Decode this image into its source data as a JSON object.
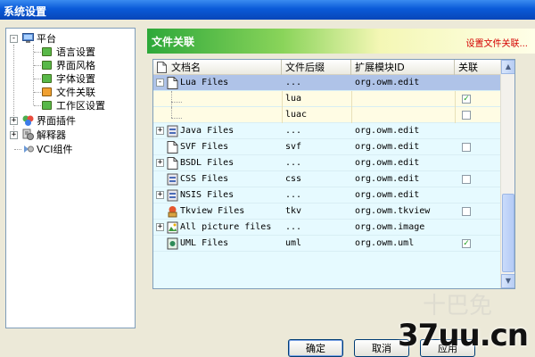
{
  "window": {
    "title": "系统设置"
  },
  "tree": {
    "nodes": [
      {
        "label": "平台",
        "icon": "monitor-icon",
        "expanded": true
      },
      {
        "label": "语言设置",
        "icon": "green-box-icon"
      },
      {
        "label": "界面风格",
        "icon": "green-box-icon"
      },
      {
        "label": "字体设置",
        "icon": "green-box-icon"
      },
      {
        "label": "文件关联",
        "icon": "orange-box-icon"
      },
      {
        "label": "工作区设置",
        "icon": "green-box-icon"
      },
      {
        "label": "界面插件",
        "icon": "puzzle-icon",
        "expanded": false
      },
      {
        "label": "解释器",
        "icon": "gears-icon",
        "expanded": false
      },
      {
        "label": "VCI组件",
        "icon": "components-icon"
      }
    ]
  },
  "panel": {
    "title": "文件关联",
    "subtitle": "设置文件关联..."
  },
  "grid": {
    "columns": [
      "文档名",
      "文件后缀",
      "扩展模块ID",
      "关联"
    ],
    "rows": [
      {
        "name": "Lua Files",
        "ext": "...",
        "module": "org.owm.edit",
        "checked": null,
        "expander": "-",
        "selected": true
      },
      {
        "name": "",
        "ext": "lua",
        "module": "",
        "checked": true,
        "child": true
      },
      {
        "name": "",
        "ext": "luac",
        "module": "",
        "checked": false,
        "child": true
      },
      {
        "name": "Java Files",
        "ext": "...",
        "module": "org.owm.edit",
        "checked": null,
        "expander": "+"
      },
      {
        "name": "SVF Files",
        "ext": "svf",
        "module": "org.owm.edit",
        "checked": false
      },
      {
        "name": "BSDL Files",
        "ext": "...",
        "module": "org.owm.edit",
        "checked": null,
        "expander": "+"
      },
      {
        "name": "CSS Files",
        "ext": "css",
        "module": "org.owm.edit",
        "checked": false
      },
      {
        "name": "NSIS Files",
        "ext": "...",
        "module": "org.owm.edit",
        "checked": null,
        "expander": "+"
      },
      {
        "name": "Tkview Files",
        "ext": "tkv",
        "module": "org.owm.tkview",
        "checked": false
      },
      {
        "name": "All picture files",
        "ext": "...",
        "module": "org.owm.image",
        "checked": null,
        "expander": "+"
      },
      {
        "name": "UML Files",
        "ext": "uml",
        "module": "org.owm.uml",
        "checked": true
      }
    ]
  },
  "buttons": {
    "ok": "确定",
    "cancel": "取消",
    "apply": "应用"
  },
  "watermark": {
    "text": "37uu.cn",
    "faint": "十巴免"
  },
  "colors": {
    "accent": "#0A5AD8",
    "banner_green": "#2DA83A",
    "subtitle_red": "#D40000",
    "selection": "#AFC3E8"
  }
}
